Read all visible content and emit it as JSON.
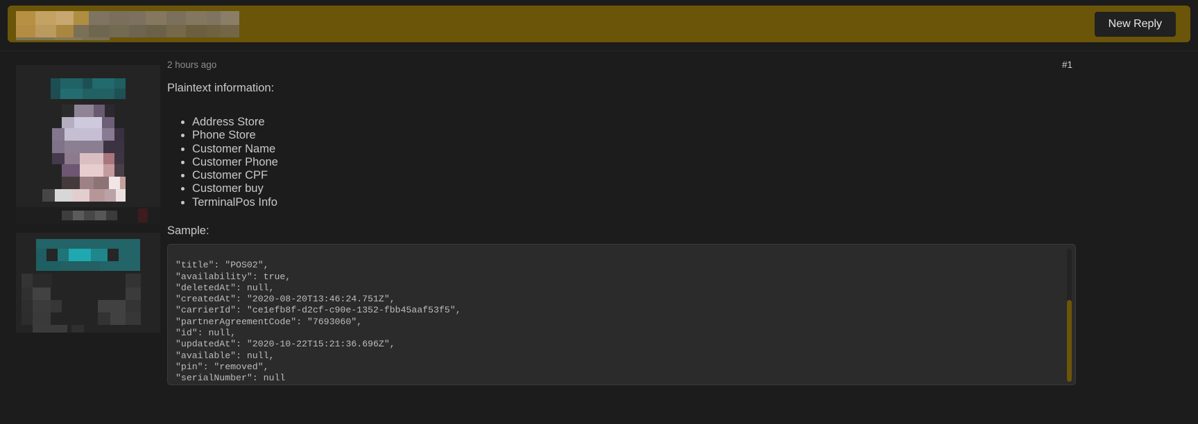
{
  "header": {
    "title_redacted": true,
    "title_placeholder": "",
    "new_reply_label": "New Reply",
    "background_color": "#6b5508"
  },
  "post": {
    "timestamp": "2 hours ago",
    "post_number": "#1",
    "plaintext_heading": "Plaintext information:",
    "info_items": [
      "Address Store",
      "Phone Store",
      "Customer Name",
      "Customer Phone",
      "Customer CPF",
      "Customer buy",
      "TerminalPos Info"
    ],
    "sample_heading": "Sample:",
    "code_sample": "\"title\": \"POS02\",\n\"availability\": true,\n\"deletedAt\": null,\n\"createdAt\": \"2020-08-20T13:46:24.751Z\",\n\"carrierId\": \"ce1efb8f-d2cf-c90e-1352-fbb45aaf53f5\",\n\"partnerAgreementCode\": \"7693060\",\n\"id\": null,\n\"updatedAt\": \"2020-10-22T15:21:36.696Z\",\n\"available\": null,\n\"pin\": \"removed\",\n\"serialNumber\": null",
    "scrollbar": {
      "thumb_color": "#6b5508",
      "track_color": "#232323"
    }
  },
  "user_cards": [
    {
      "name": "primary-author-card",
      "redacted": true,
      "banner_color": "#1d5f63"
    },
    {
      "name": "secondary-author-card",
      "redacted": true,
      "banner_color": "#1f6b70"
    }
  ],
  "theme": {
    "page_background": "#1c1c1c",
    "panel_background": "#242424",
    "code_background": "#2b2b2b",
    "text_color": "#c9c9c9",
    "muted_text_color": "#8d8d8d",
    "accent_color": "#6b5508"
  }
}
